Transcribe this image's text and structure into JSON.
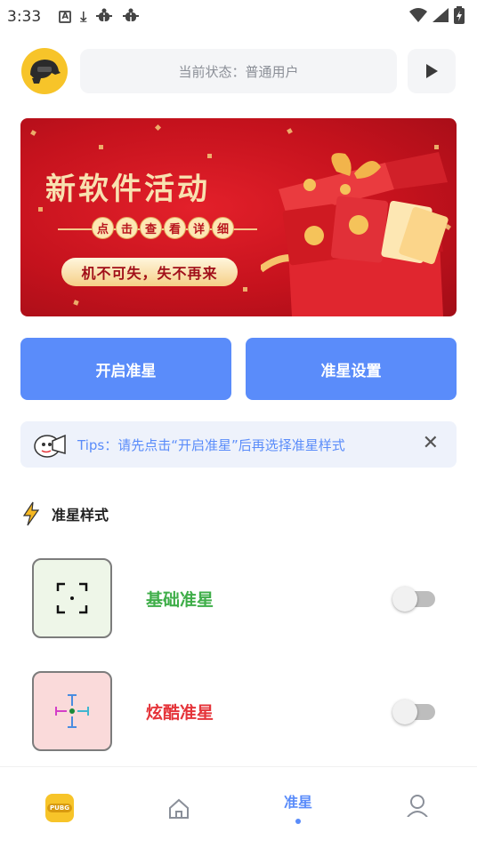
{
  "status_bar": {
    "time": "3:33",
    "left_icons": [
      "a-icon",
      "download-icon",
      "bug-icon",
      "bug-icon"
    ],
    "right_icons": [
      "wifi-icon",
      "signal-icon",
      "battery-icon"
    ]
  },
  "header": {
    "status_text": "当前状态：普通用户",
    "play_icon": "play-icon"
  },
  "banner": {
    "title": "新软件活动",
    "subtitle_chars": [
      "点",
      "击",
      "查",
      "看",
      "详",
      "细"
    ],
    "tagline": "机不可失，失不再来"
  },
  "actions": {
    "open_label": "开启准星",
    "settings_label": "准星设置"
  },
  "tips": {
    "text": "Tips：请先点击“开启准星”后再选择准星样式",
    "close": "✕"
  },
  "section": {
    "title": "准星样式"
  },
  "styles": [
    {
      "label": "基础准星",
      "enabled": false,
      "color": "#3fae49"
    },
    {
      "label": "炫酷准星",
      "enabled": false,
      "color": "#e5343a"
    }
  ],
  "bottom_nav": {
    "items": [
      {
        "icon": "pubg-icon",
        "label": ""
      },
      {
        "icon": "home-icon",
        "label": ""
      },
      {
        "icon": "crosshair-tab",
        "label": "准星",
        "active": true
      },
      {
        "icon": "user-icon",
        "label": ""
      }
    ],
    "pubg_text": "PUBG"
  },
  "colors": {
    "accent": "#5a8cfa",
    "banner_red": "#c5121d",
    "tips_bg": "#eef2fb"
  }
}
